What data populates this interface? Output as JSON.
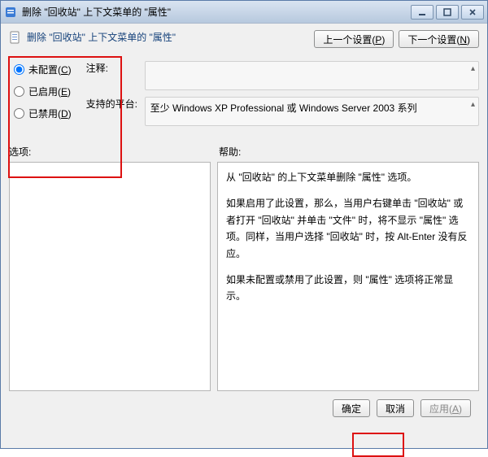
{
  "window": {
    "title": "删除 \"回收站\" 上下文菜单的 \"属性\""
  },
  "header": {
    "title": "删除 \"回收站\" 上下文菜单的 \"属性\""
  },
  "nav": {
    "prev": "上一个设置(",
    "prev_key": "P",
    "next": "下一个设置(",
    "next_key": "N",
    "suffix": ")"
  },
  "radios": {
    "not_configured": "未配置(",
    "not_configured_key": "C",
    "enabled": "已启用(",
    "enabled_key": "E",
    "disabled": "已禁用(",
    "disabled_key": "D",
    "suffix": ")"
  },
  "meta": {
    "comment_label": "注释:",
    "platform_label": "支持的平台:",
    "platform_value": "至少 Windows XP Professional 或 Windows Server 2003 系列"
  },
  "panels": {
    "options_label": "选项:",
    "help_label": "帮助:"
  },
  "help": {
    "p1": "从 \"回收站\" 的上下文菜单删除 \"属性\" 选项。",
    "p2": "如果启用了此设置，那么，当用户右键单击 \"回收站\" 或者打开 \"回收站\" 并单击 \"文件\" 时，将不显示 \"属性\" 选项。同样，当用户选择 \"回收站\" 时，按 Alt-Enter 没有反应。",
    "p3": "如果未配置或禁用了此设置，则 \"属性\" 选项将正常显示。"
  },
  "footer": {
    "ok": "确定",
    "cancel": "取消",
    "apply": "应用(",
    "apply_key": "A",
    "suffix": ")"
  }
}
